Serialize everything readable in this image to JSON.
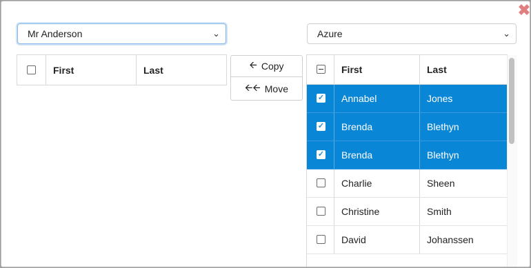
{
  "dialog": {
    "close_label": "✖"
  },
  "left": {
    "selected_group": "Mr Anderson",
    "columns": {
      "first": "First",
      "last": "Last"
    }
  },
  "right": {
    "selected_group": "Azure",
    "columns": {
      "first": "First",
      "last": "Last"
    },
    "rows": [
      {
        "first": "Annabel",
        "last": "Jones",
        "checked": true
      },
      {
        "first": "Brenda",
        "last": "Blethyn",
        "checked": true
      },
      {
        "first": "Brenda",
        "last": "Blethyn",
        "checked": true
      },
      {
        "first": "Charlie",
        "last": "Sheen",
        "checked": false
      },
      {
        "first": "Christine",
        "last": "Smith",
        "checked": false
      },
      {
        "first": "David",
        "last": "Johanssen",
        "checked": false
      }
    ]
  },
  "actions": {
    "copy_label": "Copy",
    "move_label": "Move"
  },
  "colors": {
    "selection": "#0a86d6",
    "close": "#e07f7f",
    "focus": "#86b7e8"
  }
}
